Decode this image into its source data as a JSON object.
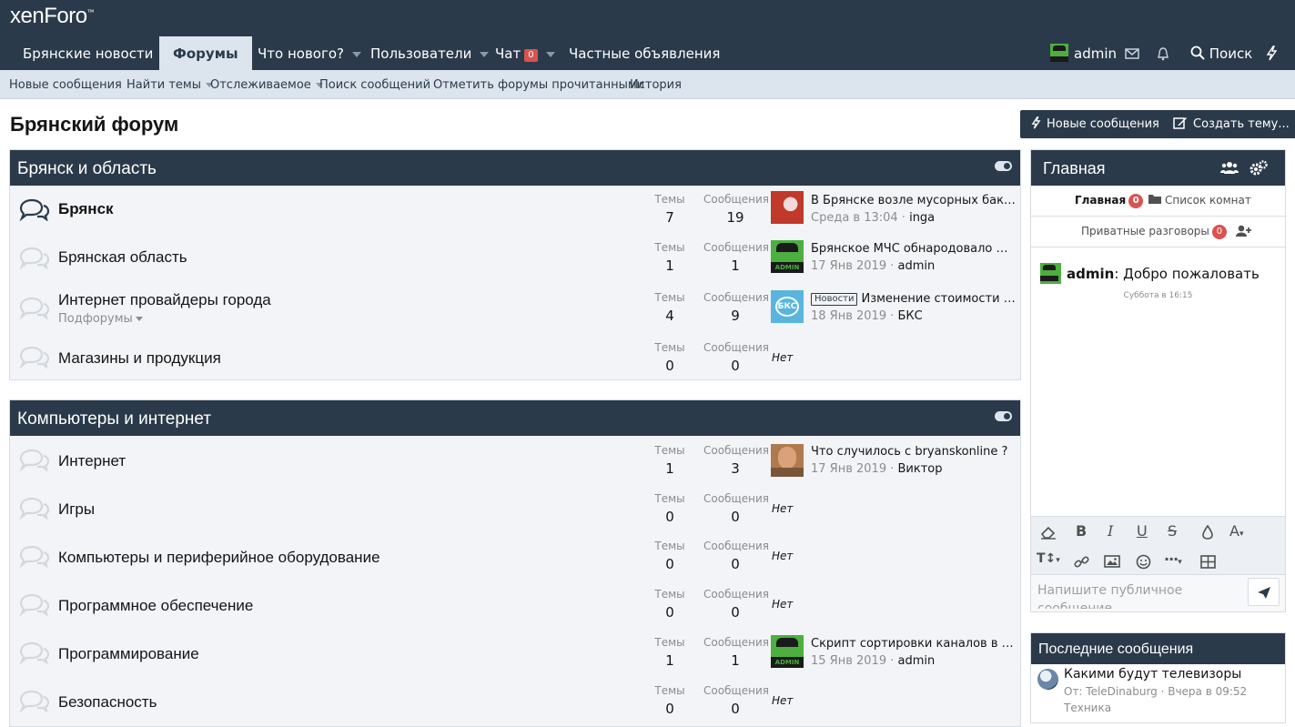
{
  "logo": {
    "text": "xenForo",
    "tm": "™"
  },
  "nav": {
    "items": [
      {
        "label": "Брянские новости"
      },
      {
        "label": "Форумы"
      },
      {
        "label": "Что нового?"
      },
      {
        "label": "Пользователи"
      },
      {
        "label": "Чат",
        "badge": "0"
      },
      {
        "label": "Частные объявления"
      }
    ],
    "user": "admin",
    "search": "Поиск"
  },
  "subnav": [
    "Новые сообщения",
    "Найти темы",
    "Отслеживаемое",
    "Поиск сообщений",
    "Отметить форумы прочитанными",
    "История"
  ],
  "page": {
    "title": "Брянский форум",
    "new_posts_btn": "Новые сообщения",
    "create_thread_btn": "Создать тему..."
  },
  "labels": {
    "threads": "Темы",
    "messages": "Сообщения",
    "none": "Нет",
    "subforums": "Подфорумы"
  },
  "categories": [
    {
      "title": "Брянск и область",
      "nodes": [
        {
          "title": "Брянск",
          "threads": "7",
          "messages": "19",
          "last_title": "В Брянске возле мусорных баков у...",
          "last_date": "Среда в 13:04",
          "last_user": "inga",
          "avatar": "red"
        },
        {
          "title": "Брянская область",
          "threads": "1",
          "messages": "1",
          "last_title": "Брянское МЧС обнародовало мест...",
          "last_date": "17 Янв 2019",
          "last_user": "admin",
          "avatar": "admin"
        },
        {
          "title": "Интернет провайдеры города",
          "threads": "4",
          "messages": "9",
          "prefix": "Новости",
          "last_title": "Изменение стоимости услу...",
          "last_date": "18 Янв 2019",
          "last_user": "БКС",
          "avatar": "bks"
        },
        {
          "title": "Магазины и продукция",
          "threads": "0",
          "messages": "0"
        }
      ]
    },
    {
      "title": "Компьютеры и интернет",
      "nodes": [
        {
          "title": "Интернет",
          "threads": "1",
          "messages": "3",
          "last_title": "Что случилось с bryanskonline ?",
          "last_date": "17 Янв 2019",
          "last_user": "Виктор",
          "avatar": "face"
        },
        {
          "title": "Игры",
          "threads": "0",
          "messages": "0"
        },
        {
          "title": "Компьютеры и периферийное оборудование",
          "threads": "0",
          "messages": "0"
        },
        {
          "title": "Программное обеспечение",
          "threads": "0",
          "messages": "0"
        },
        {
          "title": "Программирование",
          "threads": "1",
          "messages": "1",
          "last_title": "Скрипт сортировки каналов в авто...",
          "last_date": "15 Янв 2019",
          "last_user": "admin",
          "avatar": "admin"
        },
        {
          "title": "Безопасность",
          "threads": "0",
          "messages": "0"
        }
      ]
    }
  ],
  "chat": {
    "title": "Главная",
    "tab_main": "Главная",
    "tab_main_badge": "0",
    "tab_rooms": "Список комнат",
    "tab_private": "Приватные разговоры",
    "tab_private_badge": "0",
    "msg_user": "admin",
    "msg_text": ": Добро пожаловать",
    "msg_time": "Суббота в 16:15",
    "input_placeholder": "Напишите публичное сообщение"
  },
  "latest": {
    "title": "Последние сообщения",
    "item_title": "Какими будут телевизоры",
    "item_meta": "От: TeleDinaburg · Вчера в 09:52",
    "item_forum": "Техника"
  }
}
